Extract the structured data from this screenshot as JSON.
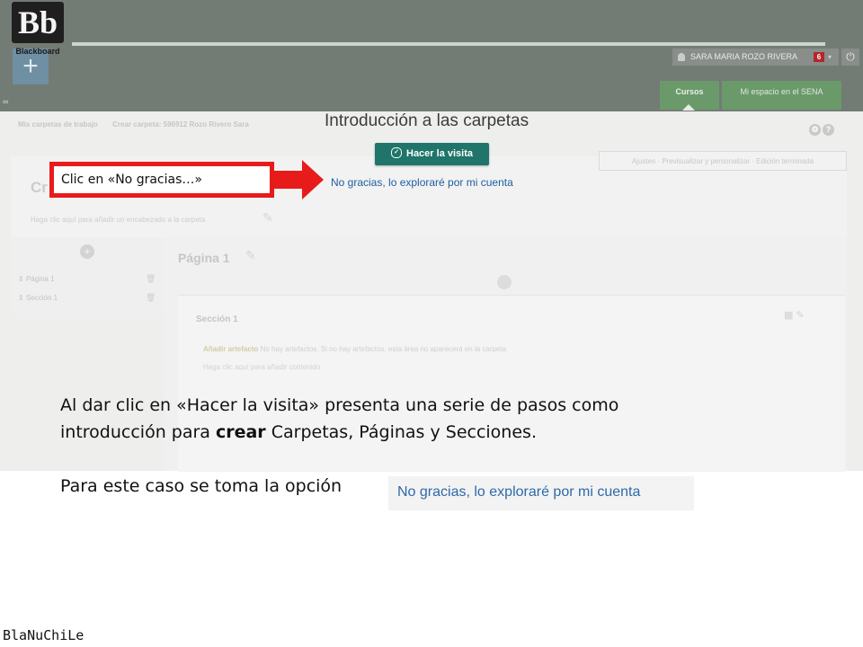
{
  "header": {
    "logo_text": "Bb",
    "logo_word": "Blackboard",
    "add_button": "+",
    "user_name": "SARA MARIA ROZO RIVERA",
    "notification_count": "6",
    "tabs": [
      {
        "label": "Cursos"
      },
      {
        "label": "Mi espacio en el SENA"
      }
    ]
  },
  "breadcrumbs": [
    "Mis carpetas de trabajo",
    "Crear carpeta: 596912 Rozo Rivero Sara"
  ],
  "toolbar_text": "Ajustes  ·  Previsualizar y personalizar  ·  Edición terminada",
  "folder": {
    "title_partial": "Cr",
    "heading_hint": "Haga clic aquí para añadir un encabezado a la carpeta"
  },
  "tree": {
    "items": [
      {
        "label": "Página 1"
      },
      {
        "label": "Sección 1"
      }
    ]
  },
  "page": {
    "title": "Página 1",
    "section_title": "Sección 1",
    "add_artifact": "Añadir artefacto",
    "artifact_note": "No hay artefactos. Si no hay artefactos, esta área no aparecerá en la carpeta",
    "content_hint": "Haga clic aquí para añadir contenido"
  },
  "tour": {
    "title": "Introducción a las carpetas",
    "visit_button": "Hacer la visita",
    "decline_link": "No gracias, lo exploraré por mi cuenta"
  },
  "callout": {
    "text": "Clic en «No gracias…»",
    "color": "#e81b1b"
  },
  "instructions": {
    "line1_pre": "Al dar clic en «Hacer la visita» presenta una serie de pasos como",
    "line2_pre": "introducción para ",
    "line2_bold": "crear",
    "line2_post": " Carpetas, Páginas y Secciones.",
    "line3": "Para este caso se toma la opción",
    "option_chip": "No gracias, lo exploraré por mi cuenta"
  },
  "signature": "BlaNuChiLe",
  "colors": {
    "tour_button": "#1f7569",
    "link_blue": "#1d5fa1",
    "header_dim": "#737b75"
  }
}
